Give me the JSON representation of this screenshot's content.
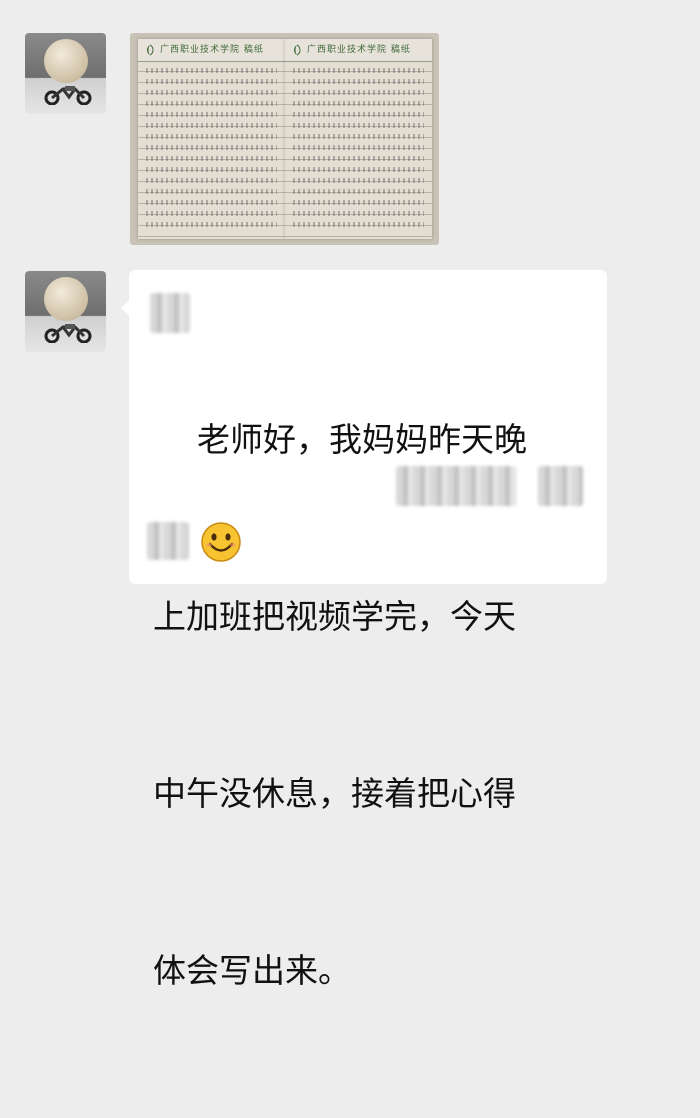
{
  "messages": [
    {
      "type": "image",
      "sender": "avatar",
      "photo": {
        "left_page_header": "广西职业技术学院  稿纸",
        "right_page_header": "广西职业技术学院  稿纸"
      }
    },
    {
      "type": "text",
      "sender": "avatar",
      "lines": [
        "老师好，我妈妈昨天晚",
        "上加班把视频学完，今天",
        "中午没休息，接着把心得",
        "体会写出来。"
      ],
      "emoji": "smile-emoji"
    }
  ],
  "colors": {
    "background": "#ededed",
    "bubble": "#ffffff",
    "text": "#111111",
    "emoji_face": "#f7c330"
  }
}
